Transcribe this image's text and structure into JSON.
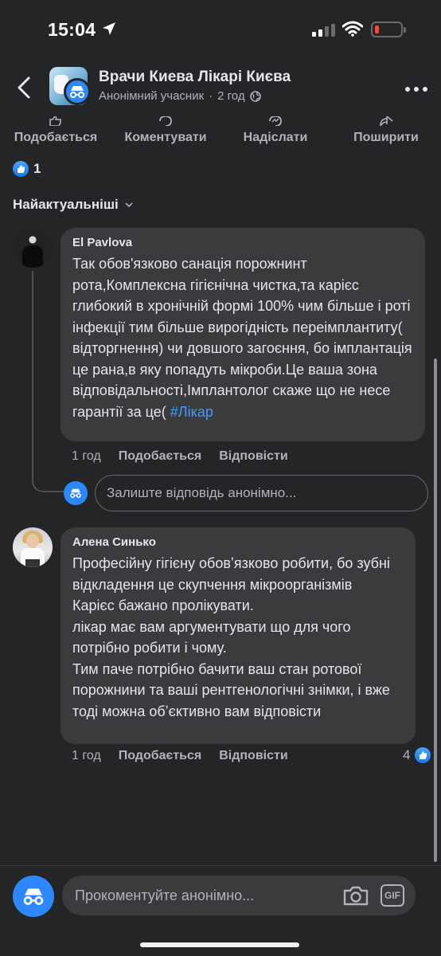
{
  "status_bar": {
    "time": "15:04"
  },
  "header": {
    "group_name": "Врачи Киева Лікарі Києва",
    "author": "Анонімний учасник",
    "separator": "·",
    "time": "2 год"
  },
  "actions": [
    {
      "label": "Подобається",
      "icon": "thumbs-up-icon"
    },
    {
      "label": "Коментувати",
      "icon": "comment-icon"
    },
    {
      "label": "Надіслати",
      "icon": "messenger-icon"
    },
    {
      "label": "Поширити",
      "icon": "share-icon"
    }
  ],
  "reactions": {
    "count": "1"
  },
  "sort": {
    "label": "Найактуальніші"
  },
  "comments": [
    {
      "author": "El Pavlova",
      "text": "Так обов'язково санація порожнинт рота,Комплексна гігієнічна чистка,та карієс глибокий в хронічній формі 100% чим більше і роті інфекції тим більше вирогідність переімплантиту( відторгнення) чи довшого загоєння, бо імплантація це рана,в яку попадуть мікроби.Це ваша зона відповідальності,Імплантолог скаже що не несе гарантії за це( ",
      "hashtag": "#Лікар",
      "time": "1 год",
      "like_label": "Подобається",
      "reply_label": "Відповісти"
    },
    {
      "author": "Алена Синько",
      "text": "Професійну гігієну обовʼязково робити, бо зубні відкладення  це скупчення мікроорганізмів\nКарієс бажано пролікувати.\nлікар має вам аргументувати що для чого потрібно робити і чому.\nТим паче потрібно бачити ваш стан ротової порожнини та  ваші рентгенологічні знімки, і вже тоді можна обʼєктивно вам відповісти",
      "time": "1 год",
      "like_label": "Подобається",
      "reply_label": "Відповісти",
      "likes": "4"
    }
  ],
  "reply": {
    "placeholder": "Залиште відповідь анонімно..."
  },
  "composer": {
    "placeholder": "Прокоментуйте анонімно...",
    "gif_label": "GIF"
  },
  "colors": {
    "accent": "#2d88ff",
    "link": "#4599ff",
    "background": "#242526",
    "bubble": "#3a3b3c"
  }
}
